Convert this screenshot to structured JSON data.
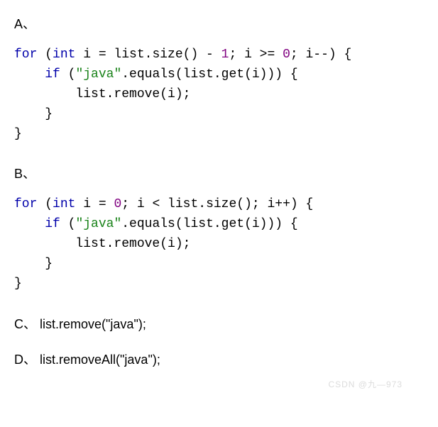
{
  "options": {
    "a": {
      "label": "A、",
      "code": {
        "kw_for": "for",
        "type_int": "int",
        "var_i1": " i = list.size() - ",
        "num_1": "1",
        "cond_tail": "; i >= ",
        "num_0a": "0",
        "iter": "; i--) {",
        "kw_if": "if",
        "if_open": " (",
        "str_java": "\"java\"",
        "if_tail": ".equals(list.get(i))) {",
        "remove_line": "        list.remove(i);",
        "close1": "    }",
        "close2": "}"
      }
    },
    "b": {
      "label": "B、",
      "code": {
        "kw_for": "for",
        "type_int": "int",
        "var_i1": " i = ",
        "num_0": "0",
        "cond_tail": "; i < list.size(); i++) {",
        "kw_if": "if",
        "if_open": " (",
        "str_java": "\"java\"",
        "if_tail": ".equals(list.get(i))) {",
        "remove_line": "        list.remove(i);",
        "close1": "    }",
        "close2": "}"
      }
    },
    "c": {
      "label": "C、",
      "text": "list.remove(\"java\");"
    },
    "d": {
      "label": "D、",
      "text": "list.removeAll(\"java\");"
    }
  },
  "watermark": "CSDN @九—973"
}
